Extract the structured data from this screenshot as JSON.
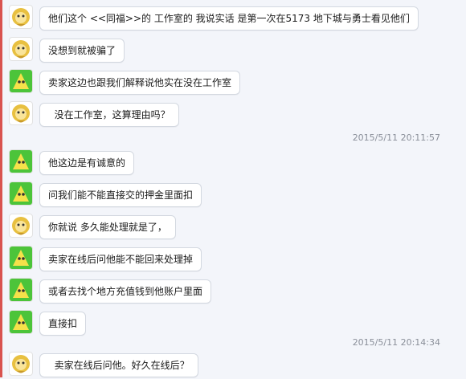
{
  "messages": [
    {
      "avatar": "user-gold-avatar",
      "text": "他们这个 <<同福>>的 工作室的 我说实话 是第一次在5173 地下城与勇士看见他们"
    },
    {
      "avatar": "user-gold-avatar",
      "text": "没想到就被骗了"
    },
    {
      "avatar": "service-green-avatar",
      "text": "卖家这边也跟我们解释说他实在没在工作室"
    },
    {
      "avatar": "user-gold-avatar",
      "text": "  没在工作室，这算理由吗？"
    },
    {
      "avatar": "service-green-avatar",
      "text": "他这边是有诚意的"
    },
    {
      "avatar": "service-green-avatar",
      "text": "问我们能不能直接交的押金里面扣"
    },
    {
      "avatar": "user-gold-avatar",
      "text": "你就说 多久能处理就是了，"
    },
    {
      "avatar": "service-green-avatar",
      "text": "卖家在线后问他能不能回来处理掉"
    },
    {
      "avatar": "service-green-avatar",
      "text": "或者去找个地方充值钱到他账户里面"
    },
    {
      "avatar": "service-green-avatar",
      "text": "直接扣"
    },
    {
      "avatar": "user-gold-avatar",
      "text": "  卖家在线后问他。好久在线后？"
    }
  ],
  "timestamps": [
    "2015/5/11 20:11:57",
    "2015/5/11 20:14:34"
  ],
  "colors": {
    "left_accent": "#d9534f",
    "bubble_bg": "#ffffff",
    "timestamp": "#8a8f99"
  }
}
